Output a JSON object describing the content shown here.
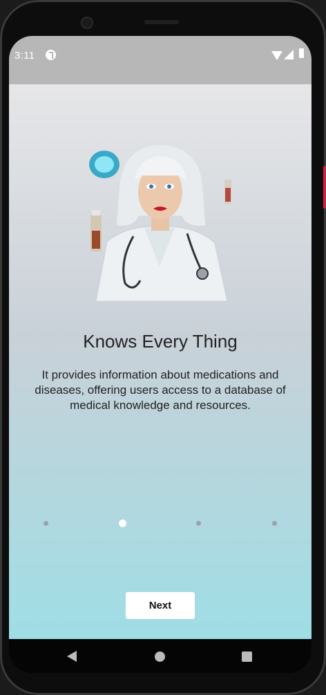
{
  "status_bar": {
    "time": "3:11"
  },
  "onboarding": {
    "title": "Knows Every Thing",
    "description": "It provides information about medications and diseases, offering users access to a database of medical knowledge and resources.",
    "next_label": "Next",
    "page_indicator": {
      "total": 4,
      "active": 2
    }
  },
  "colors": {
    "gradient_top": "#e6e6e8",
    "gradient_bottom": "#9fdde5",
    "status_bar": "#b7b7b7"
  },
  "icons": [
    "wifi-icon",
    "signal-icon",
    "battery-icon",
    "app-notification-icon",
    "back-icon",
    "home-icon",
    "recents-icon"
  ]
}
